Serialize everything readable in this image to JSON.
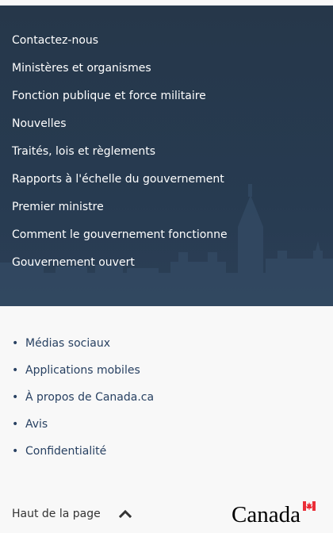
{
  "main_links": [
    "Contactez-nous",
    "Ministères et organismes",
    "Fonction publique et force militaire",
    "Nouvelles",
    "Traités, lois et règlements",
    "Rapports à l'échelle du gouvernement",
    "Premier ministre",
    "Comment le gouvernement fonctionne",
    "Gouvernement ouvert"
  ],
  "sub_links": [
    "Médias sociaux",
    "Applications mobiles",
    "À propos de Canada.ca",
    "Avis",
    "Confidentialité"
  ],
  "bullet": "•",
  "top_link": "Haut de la page",
  "wordmark": "Canada",
  "colors": {
    "footer_bg": "#26374a",
    "link_dark": "#284162",
    "flag_red": "#eb2d37"
  }
}
